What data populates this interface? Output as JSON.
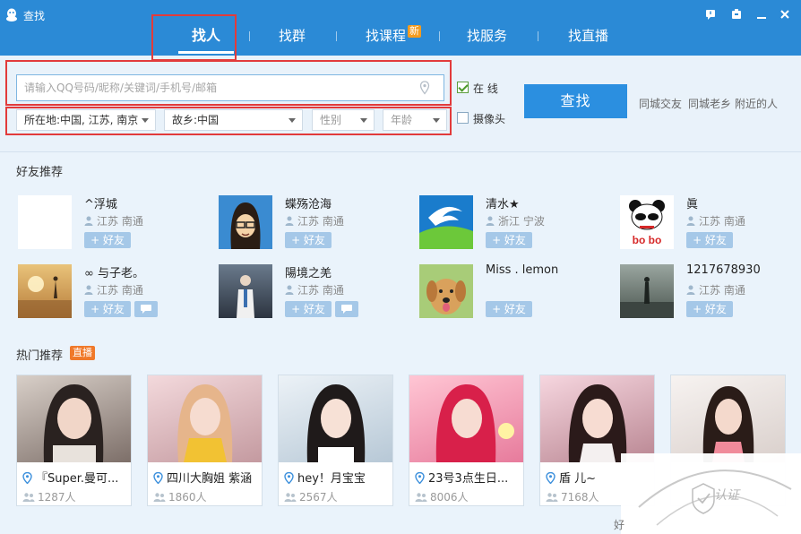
{
  "window": {
    "title": "查找",
    "brand_color": "#2b8ad6",
    "logo_icon": "penguin-icon",
    "controls": [
      "feedback-icon",
      "skin-icon",
      "minimize-icon",
      "close-icon"
    ]
  },
  "tabs": [
    {
      "label": "找人",
      "active": true
    },
    {
      "label": "找群"
    },
    {
      "label": "找课程",
      "badge": "新"
    },
    {
      "label": "找服务"
    },
    {
      "label": "找直播"
    }
  ],
  "search": {
    "placeholder": "请输入QQ号码/昵称/关键词/手机号/邮箱",
    "location_filter": "所在地:中国, 江苏, 南京",
    "hometown_filter": "故乡:中国",
    "gender_filter": "性别",
    "age_filter": "年龄",
    "online_label": "在  线",
    "online_checked": true,
    "camera_label": "摄像头",
    "camera_checked": false,
    "search_button": "查找",
    "quick_links": [
      "同城交友",
      "同城老乡",
      "附近的人"
    ]
  },
  "friends": {
    "title": "好友推荐",
    "add_label": "+ 好友",
    "items": [
      {
        "name": "^浮城",
        "location": "江苏 南通",
        "has_msg": false
      },
      {
        "name": "蝶殇沧海",
        "location": "江苏 南通",
        "has_msg": false
      },
      {
        "name": "清水★",
        "location": "浙江 宁波",
        "has_msg": false
      },
      {
        "name": "眞",
        "location": "江苏 南通",
        "has_msg": false
      },
      {
        "name": "∞ 与子老。",
        "location": "江苏 南通",
        "has_msg": true
      },
      {
        "name": "陽境之羌",
        "location": "江苏 南通",
        "has_msg": true
      },
      {
        "name": "Miss . lemon",
        "location": "",
        "has_msg": false
      },
      {
        "name": "1217678930",
        "location": "江苏 南通",
        "has_msg": false
      }
    ]
  },
  "live": {
    "title": "热门推荐",
    "badge": "直播",
    "items": [
      {
        "title": "『Super.曼可...",
        "viewers": "1287人"
      },
      {
        "title": "四川大胸姐 紫涵",
        "viewers": "1860人"
      },
      {
        "title": "hey！月宝宝",
        "viewers": "2567人"
      },
      {
        "title": "23号3点生日...",
        "viewers": "8006人"
      },
      {
        "title": "盾 儿~",
        "viewers": "7168人"
      },
      {
        "title": "",
        "viewers": ""
      }
    ]
  },
  "watermark": {
    "text": "认证"
  },
  "footer": {
    "text": "好"
  }
}
